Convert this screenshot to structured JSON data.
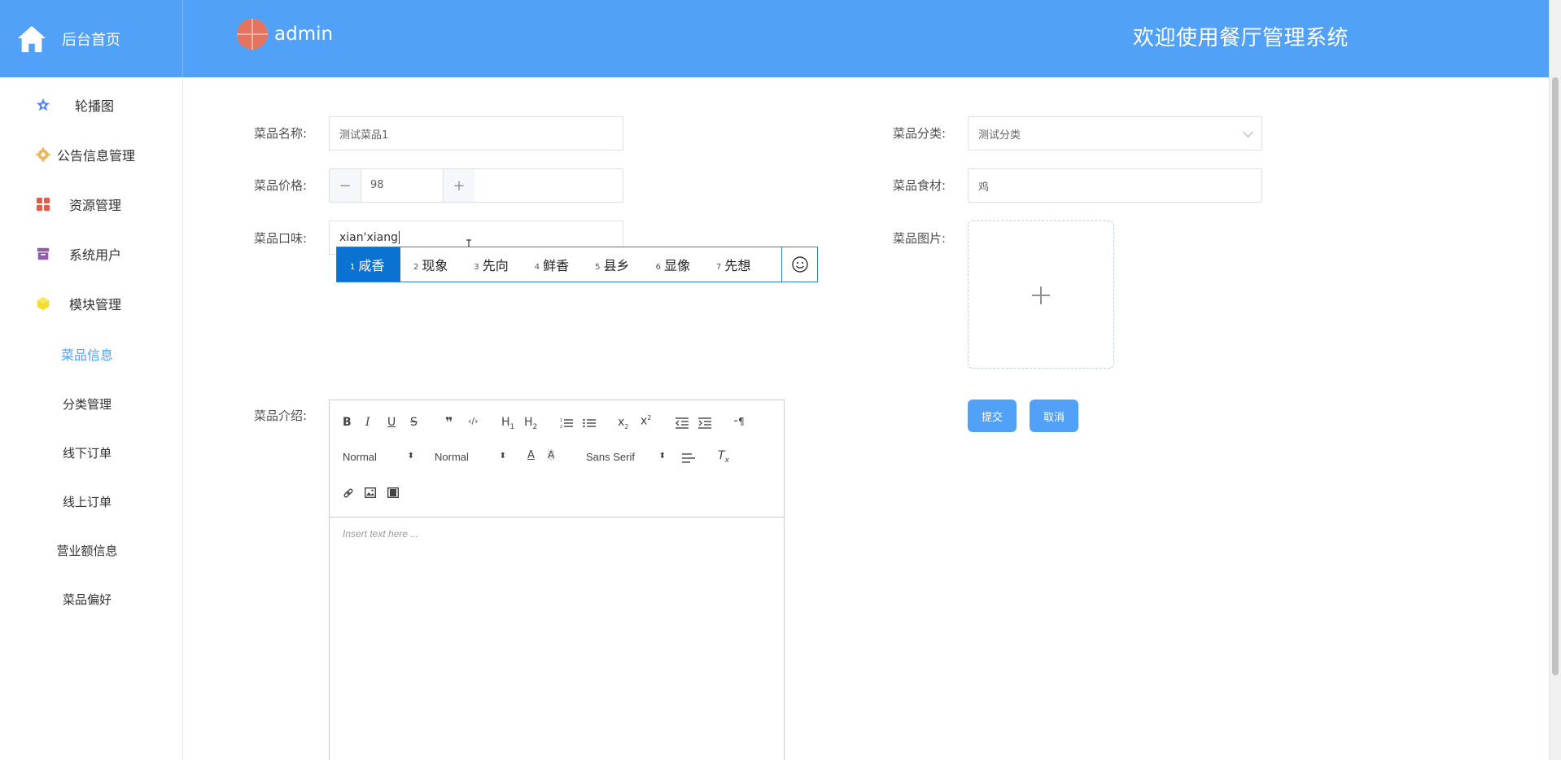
{
  "header": {
    "home_label": "后台首页",
    "username": "admin",
    "system_title": "欢迎使用餐厅管理系统",
    "color": "#52a1f9"
  },
  "sidebar": {
    "items": [
      {
        "label": "轮播图",
        "icon": "star-icon"
      },
      {
        "label": "公告信息管理",
        "icon": "gear-icon"
      },
      {
        "label": "资源管理",
        "icon": "grid-icon"
      },
      {
        "label": "系统用户",
        "icon": "box-icon"
      },
      {
        "label": "模块管理",
        "icon": "cube-icon"
      }
    ],
    "subitems": [
      {
        "label": "菜品信息",
        "active": true
      },
      {
        "label": "分类管理"
      },
      {
        "label": "线下订单"
      },
      {
        "label": "线上订单"
      },
      {
        "label": "营业额信息"
      },
      {
        "label": "菜品偏好"
      }
    ]
  },
  "form": {
    "name_label": "菜品名称:",
    "name_value": "测试菜品1",
    "price_label": "菜品价格:",
    "price_value": "98",
    "taste_label": "菜品口味:",
    "taste_value": "xian'xiang",
    "category_label": "菜品分类:",
    "category_value": "测试分类",
    "ingredient_label": "菜品食材:",
    "ingredient_value": "鸡",
    "image_label": "菜品图片:",
    "intro_label": "菜品介绍:",
    "submit_label": "提交",
    "cancel_label": "取消"
  },
  "ime": {
    "candidates": [
      {
        "num": "1",
        "text": "咸香"
      },
      {
        "num": "2",
        "text": "现象"
      },
      {
        "num": "3",
        "text": "先向"
      },
      {
        "num": "4",
        "text": "鲜香"
      },
      {
        "num": "5",
        "text": "县乡"
      },
      {
        "num": "6",
        "text": "显像"
      },
      {
        "num": "7",
        "text": "先想"
      }
    ]
  },
  "editor": {
    "header_select": "Normal",
    "size_select": "Normal",
    "font_select": "Sans Serif",
    "placeholder": "Insert text here ..."
  }
}
